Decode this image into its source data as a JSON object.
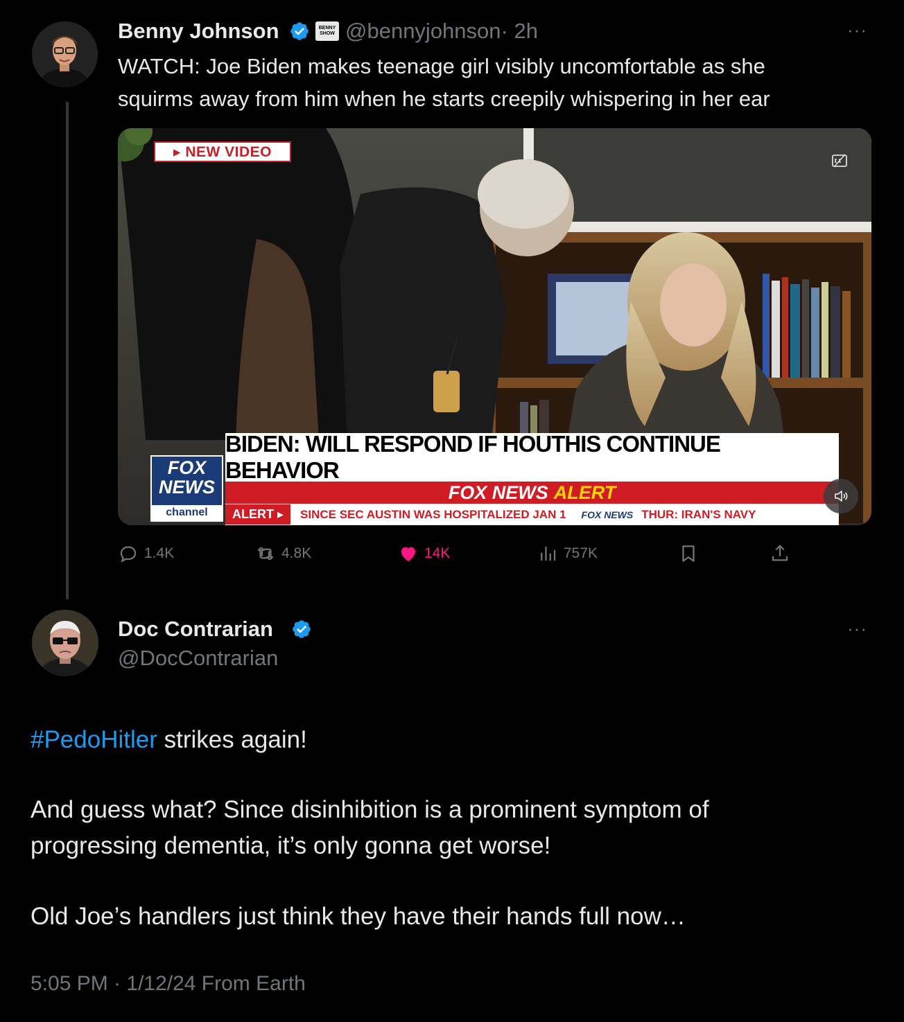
{
  "tweet": {
    "author_name": "Benny Johnson",
    "handle": "@bennyjohnson",
    "time": "· 2h",
    "badge_text": "BENNY SHOW",
    "text_line1": "WATCH: Joe Biden makes teenage girl visibly uncomfortable as she",
    "text_line2": "squirms away from him when he starts creepily whispering in her ear",
    "more": "···",
    "video": {
      "new_video_tag": "▸ NEW VIDEO",
      "headline": "BIDEN: WILL RESPOND IF HOUTHIS CONTINUE BEHAVIOR",
      "alert_bar": "FOX NEWS ALERT",
      "alert_fox": "FOX NEWS",
      "alert_word": "ALERT",
      "ticker_label": "ALERT ▸",
      "ticker_text": "SINCE SEC AUSTIN WAS HOSPITALIZED JAN 1",
      "ticker_fox": "FOX NEWS",
      "ticker_text2": "THUR: IRAN'S NAVY",
      "logo_line1": "FOX",
      "logo_line2": "NEWS",
      "logo_line3": "channel"
    },
    "stats": {
      "replies": "1.4K",
      "reposts": "4.8K",
      "likes": "14K",
      "views": "757K"
    },
    "colors": {
      "like": "#f91880",
      "verified": "#1d9bf0",
      "muted": "#71767b"
    }
  },
  "reply": {
    "author_name": "Doc Contrarian",
    "handle": "@DocContrarian",
    "more": "···",
    "hashtag": "#PedoHitler",
    "line1_rest": " strikes again!",
    "para2_line1": "And guess what? Since disinhibition is a prominent symptom of",
    "para2_line2": "progressing dementia, it’s only gonna get worse!",
    "para3": "Old Joe’s handlers just think they have their hands full now…",
    "meta": "5:05 PM · 1/12/24 From Earth"
  }
}
